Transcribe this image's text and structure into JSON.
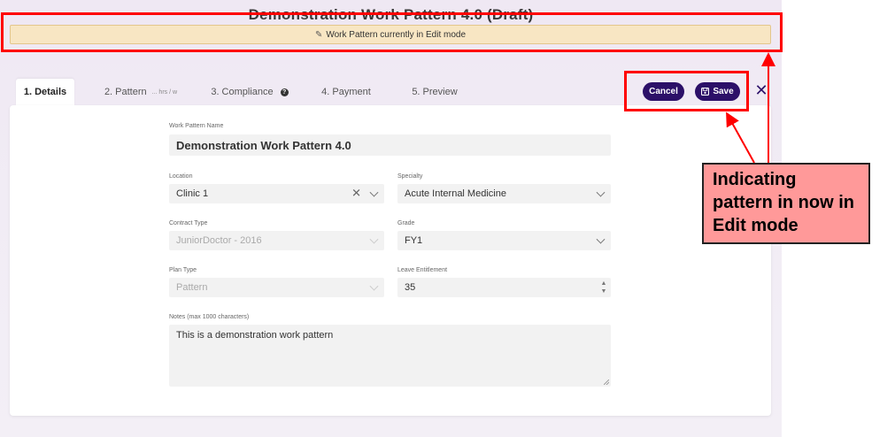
{
  "page": {
    "title": "Demonstration Work Pattern 4.0 (Draft)",
    "edit_banner": "Work Pattern currently in Edit mode"
  },
  "tabs": [
    {
      "label": "1. Details",
      "active": true
    },
    {
      "label": "2. Pattern",
      "sub": "... hrs / w"
    },
    {
      "label": "3. Compliance"
    },
    {
      "label": "4. Payment"
    },
    {
      "label": "5. Preview"
    }
  ],
  "actions": {
    "cancel_label": "Cancel",
    "save_label": "Save"
  },
  "form": {
    "name": {
      "label": "Work Pattern Name",
      "value": "Demonstration Work Pattern 4.0"
    },
    "location": {
      "label": "Location",
      "value": "Clinic 1"
    },
    "specialty": {
      "label": "Specialty",
      "value": "Acute Internal Medicine"
    },
    "contract_type": {
      "label": "Contract Type",
      "value": "JuniorDoctor - 2016"
    },
    "grade": {
      "label": "Grade",
      "value": "FY1"
    },
    "plan_type": {
      "label": "Plan Type",
      "value": "Pattern"
    },
    "leave_entitlement": {
      "label": "Leave Entitlement",
      "value": "35"
    },
    "notes": {
      "label": "Notes (max 1000 characters)",
      "value": "This is a demonstration work pattern"
    }
  },
  "annotation": {
    "callout_text": "Indicating pattern in now in Edit mode",
    "color": "#ff0000",
    "callout_fill": "#ff9999"
  },
  "colors": {
    "accent": "#2c1068",
    "banner": "#f8e6c3"
  }
}
